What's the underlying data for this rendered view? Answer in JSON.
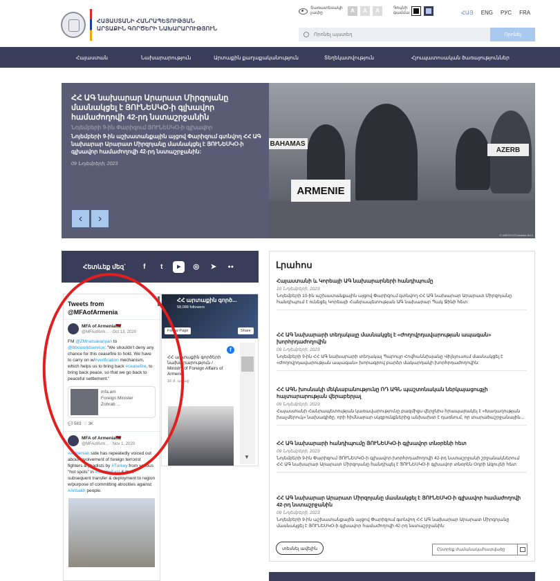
{
  "header": {
    "logo_line1": "ՀԱՅԱՍՏԱՆԻ ՀԱՆՐԱՊԵՏՈՒԹՅԱՆ",
    "logo_line2": "ԱՐՏԱՔԻՆ ԳՈՐԾԵՐԻ ՆԱԽԱՐԱՐՈՒԹՅՈՒՆ",
    "accessibility_label": "Տառատեսակի չափը",
    "font_sizes": [
      "A",
      "A",
      "A"
    ],
    "color_label": "Գույնի գամմա",
    "languages": [
      "ՀԱՅ",
      "ENG",
      "РУС",
      "FRA"
    ],
    "search_placeholder": "Որոնել այստեղ",
    "search_button": "Որոնել"
  },
  "nav": [
    "Հայաստան",
    "Նախարարություն",
    "Արտաքին քաղաքականություն",
    "Տեղեկատվություն",
    "Հյուպատոսական ծառայություններ"
  ],
  "hero": {
    "title": "ՀՀ ԱԳ նախարար Արարատ Միրզոյանը մասնակցել է ՅՈՒՆԵՍԿՕ-ի գլխավոր համաժողովի 42-րդ նստաշրջանին",
    "subtitle_faded": "Նոյեմբերի 9-ին Փարիզում ՅՈՒՆԵՍԿՕ-ի գլխավոր",
    "summary": "Նոյեմբերի 9-ին աշխատանքային այցով Փարիզում գտնվող ՀՀ ԱԳ նախարար Արարատ Միրզոյանը մասնակցել է ՅՈՒՆԵՍԿՕ-ի գլխավոր համաժողովի 42-րդ նստաշրջանին:",
    "date": "09 Նոյեմբերի, 2023",
    "plate_main": "ARMENIE",
    "plate_left": "BAHAMAS",
    "plate_right": "AZERB",
    "credit": "© UNESCO/Christelle ALIX"
  },
  "follow": {
    "label": "Հետևեք մեզ`",
    "icons": [
      "f",
      "t",
      "▶",
      "◎",
      "➤",
      "●●"
    ]
  },
  "twitter": {
    "header_line1": "Tweets from",
    "header_line2": "@MFAofArmenia",
    "tweets": [
      {
        "name": "MFA of Armenia🇦🇲",
        "handle": "@MFAofArm... · Oct 13, 2020",
        "text_start": "FM ",
        "link1": "@ZMnatsakanyan",
        "text2": " to ",
        "link2": "@bbcworldservice",
        "text3": ": \"We shouldn't deny any chance for this ceasefire to hold. We have to carry on w/",
        "link3": "#verification",
        "text4": " mechanism, which helps us to bring back ",
        "link4": "#ceasefire",
        "text5": ", to bring back peace, so that we go back to peaceful settlement.\"",
        "card_site": "mfa.am",
        "card_line2": "Foreign Minister",
        "card_line3": "Zohrab ...",
        "likes": "583",
        "retweets": "3K"
      },
      {
        "name": "MFA of Armenia🇦🇲",
        "handle": "@MFAofArm... · Nov 1, 2020",
        "link1": "#Armenian",
        "text2": " side has repeatedly voiced out about involvement of foreign terrorist fighters & jihadists by ",
        "link2": "#Turkey",
        "text3": " from various \"hot spots\" in ",
        "link3": "#MiddleEast",
        "text4": ",& their subsequent transfer & deployment to region w/purpose of committing atrocities against ",
        "link4": "#Artsakh",
        "text5": " people."
      }
    ]
  },
  "facebook": {
    "page_title": "ՀՀ արտաքին գործ...",
    "followers": "58,088 followers",
    "follow_btn": "Follow Page",
    "share_btn": "Share",
    "post_text": "ՀՀ արտաքին գործերի նախարարություն / Ministry of Foreign Affairs of Armenia",
    "post_time": "16 ժ. առաջ"
  },
  "news": {
    "heading": "Լրահոս",
    "items": [
      {
        "title": "Հայաստանի և Կորեայի ԱԳ նախարարների հանդիպումը",
        "date": "10 Նոյեմբերի, 2023",
        "text": "Նոյեմբերի 10-ին աշխատանքային այցով Փարիզում գտնվող ՀՀ ԱԳ նախարար Արարատ Միրզոյանը հանդիպում է ունեցել Կորեայի Հանրապետության ԱԳ նախարար Պակ Ջինի հետ:"
      },
      {
        "title": "ՀՀ ԱԳ նախարարի տեղակալը մասնակցել է «Ժողովրդավարության ապագան» խորհրդաժողովին",
        "date": "09 Նոյեմբերի, 2023",
        "text": "Նոյեմբերի 9-ին ՀՀ ԱԳ նախարարի տեղակալ Պարույր Հովհաննիսյանը Վիլնյուսում մասնակցել է «Ժողովրդավարության ապագան» խորագրով բարձր մակարդակի խորհրդաժողովին:"
      },
      {
        "title": "ՀՀ ԱԳՆ խոսնակի մեկնաբանությունը ՌԴ ԱԳՆ պաշտոնական ներկայացուցչի հայտարարության վերաբերյալ",
        "date": "09 Նոյեմբերի, 2023",
        "text": "Հայաստանի Հանրապետության կառավարությունը բազմիցս վերջնիս հրապարակել է «Խաղաղության խաչմերուկ» նախագիծը, որի հիմնարար սկզբունքներից անխախտ է դառնում, որ տարածաշրջանային..."
      },
      {
        "title": "ՀՀ ԱԳ նախարարի հանդիպումը ՅՈՒՆԵՍԿՕ-ի գլխավոր տնօրենի հետ",
        "date": "09 Նոյեմբերի, 2023",
        "text": "Նոյեմբերի 9-ին Փարիզում ՅՈՒՆԵՍԿՕ-ի գլխավոր խորհրդաժողովի 42-րդ նստաշրջանի շրջանակներում ՀՀ ԱԳ նախարար Արարատ Միրզոյանը հանդիպել է ՅՈՒՆԵՍԿՕ-ի գլխավոր տնօրեն Օդրի Ազուլեի հետ:"
      },
      {
        "title": "ՀՀ ԱԳ նախարար Արարատ Միրզոյանը մասնակցել է ՅՈՒՆԵՍԿՕ-ի գլխավոր համաժողովի 42-րդ նստաշրջանին",
        "date": "09 Նոյեմբերի, 2023",
        "text": "Նոյեմբերի 9-ին աշխատանքային այցով Փարիզում գտնվող ՀՀ ԱԳ նախարար Արարատ Միրզոյանը մասնակցել է ՅՈՒՆԵՍԿՕ-ի գլխավոր համաժողովի 42-րդ նստաշրջանին:"
      }
    ],
    "all_news": "տեսնել ավելին",
    "date_placeholder": "Ընտրեք ժամանակահատվածը"
  },
  "colors": {
    "nav_bg": "#3a3d59",
    "accent": "#a9c9ee",
    "annotation": "#e21e1e"
  }
}
